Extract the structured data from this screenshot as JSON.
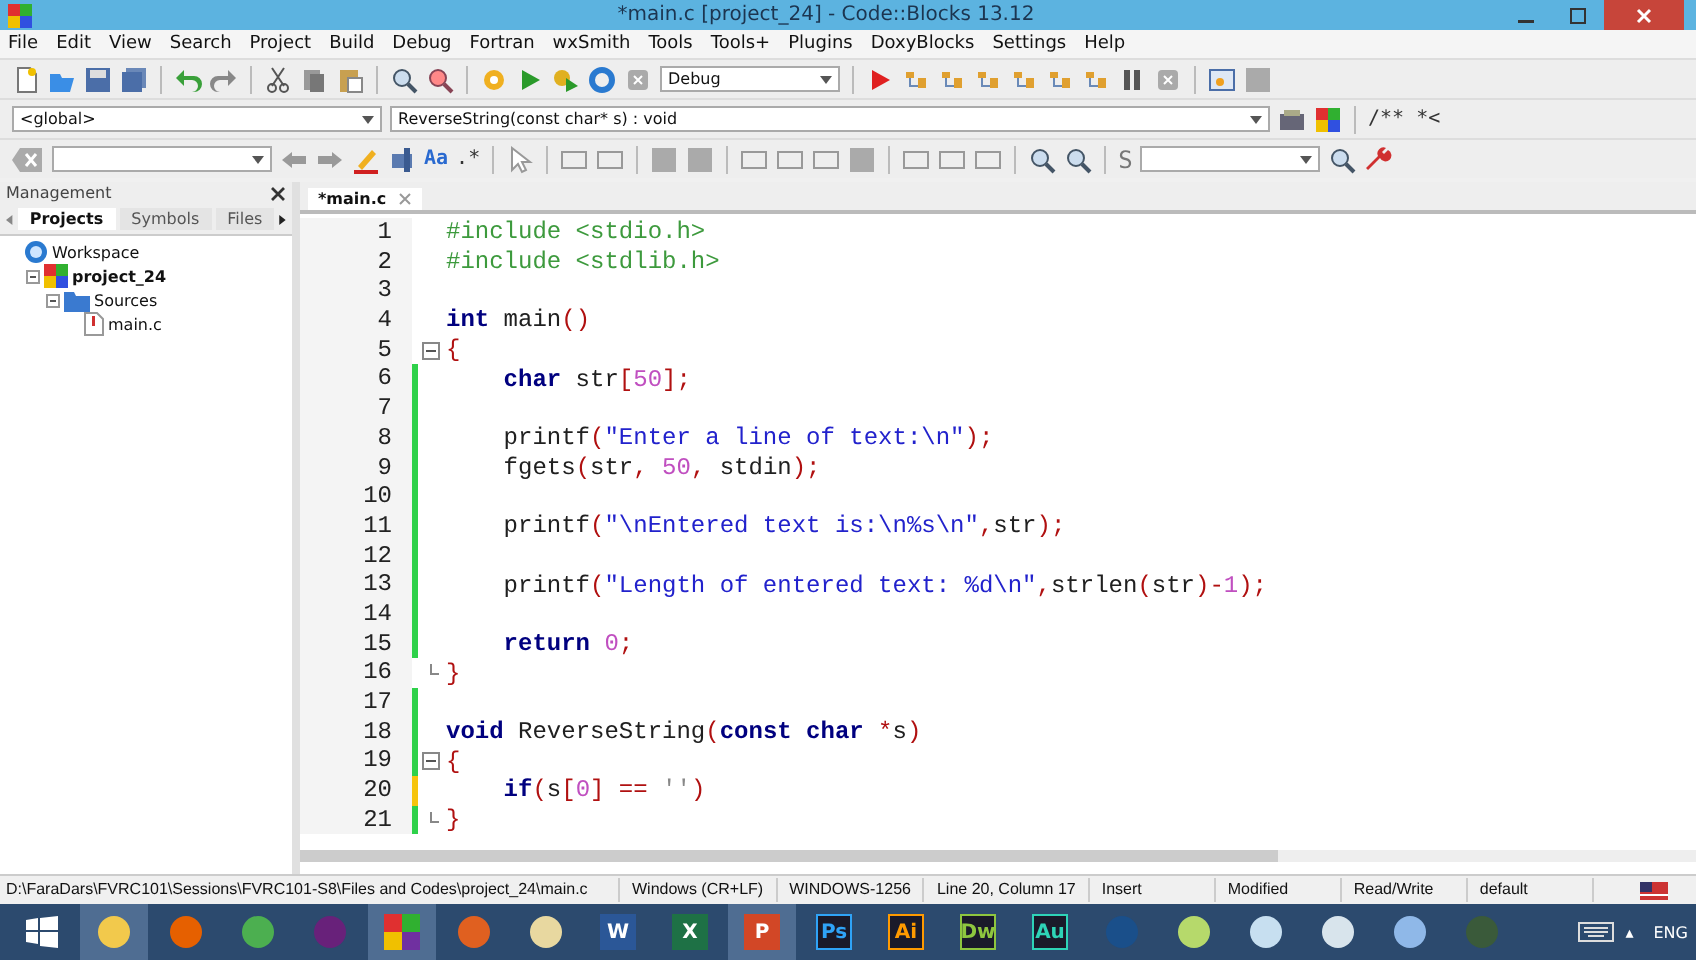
{
  "window": {
    "title": "*main.c [project_24] - Code::Blocks 13.12"
  },
  "menu": [
    "File",
    "Edit",
    "View",
    "Search",
    "Project",
    "Build",
    "Debug",
    "Fortran",
    "wxSmith",
    "Tools",
    "Tools+",
    "Plugins",
    "DoxyBlocks",
    "Settings",
    "Help"
  ],
  "toolbar": {
    "build_target": "Debug",
    "scope": "<global>",
    "function": "ReverseString(const char* s) : void",
    "doc_comment": "/** *<",
    "match_case": "Aa",
    "regex": ".*",
    "spell": "S"
  },
  "management": {
    "title": "Management",
    "tabs": [
      {
        "label": "Projects",
        "selected": true
      },
      {
        "label": "Symbols",
        "selected": false
      },
      {
        "label": "Files",
        "selected": false
      }
    ],
    "tree": [
      {
        "label": "Workspace",
        "kind": "workspace",
        "children": [
          {
            "label": "project_24",
            "kind": "project",
            "expanded": true,
            "children": [
              {
                "label": "Sources",
                "kind": "folder",
                "expanded": true,
                "children": [
                  {
                    "label": "main.c",
                    "kind": "file"
                  }
                ]
              }
            ]
          }
        ]
      }
    ]
  },
  "editor": {
    "tabs": [
      {
        "label": "*main.c",
        "selected": true
      }
    ],
    "lines": [
      {
        "n": "1",
        "tokens": [
          {
            "kind": "pre",
            "text": "#include <stdio.h>"
          }
        ]
      },
      {
        "n": "2",
        "tokens": [
          {
            "kind": "pre",
            "text": "#include <stdlib.h>"
          }
        ]
      },
      {
        "n": "3"
      },
      {
        "n": "4",
        "tokens": [
          {
            "kind": "kw",
            "text": "int"
          },
          {
            "kind": "id",
            "text": " main"
          },
          {
            "kind": "op",
            "text": "()"
          }
        ]
      },
      {
        "n": "5",
        "fold_start": true,
        "tokens": [
          {
            "kind": "op",
            "text": "{"
          }
        ]
      },
      {
        "n": "6",
        "modified": true,
        "indented": true,
        "tokens": [
          {
            "kind": "kw",
            "text": "char"
          },
          {
            "kind": "id",
            "text": " str"
          },
          {
            "kind": "op",
            "text": "["
          },
          {
            "kind": "num",
            "text": "50"
          },
          {
            "kind": "op",
            "text": "];"
          }
        ]
      },
      {
        "n": "7",
        "modified": true
      },
      {
        "n": "8",
        "modified": true,
        "indented": true,
        "tokens": [
          {
            "kind": "id",
            "text": "printf"
          },
          {
            "kind": "op",
            "text": "("
          },
          {
            "kind": "str",
            "text": "\"Enter a line of text:\\n\""
          },
          {
            "kind": "op",
            "text": ");"
          }
        ]
      },
      {
        "n": "9",
        "modified": true,
        "indented": true,
        "tokens": [
          {
            "kind": "id",
            "text": "fgets"
          },
          {
            "kind": "op",
            "text": "("
          },
          {
            "kind": "id",
            "text": "str"
          },
          {
            "kind": "op",
            "text": ", "
          },
          {
            "kind": "num",
            "text": "50"
          },
          {
            "kind": "op",
            "text": ","
          },
          {
            "kind": "id",
            "text": " stdin"
          },
          {
            "kind": "op",
            "text": ");"
          }
        ]
      },
      {
        "n": "10",
        "modified": true
      },
      {
        "n": "11",
        "modified": true,
        "indented": true,
        "tokens": [
          {
            "kind": "id",
            "text": "printf"
          },
          {
            "kind": "op",
            "text": "("
          },
          {
            "kind": "str",
            "text": "\"\\nEntered text is:\\n%s\\n\""
          },
          {
            "kind": "op",
            "text": ","
          },
          {
            "kind": "id",
            "text": "str"
          },
          {
            "kind": "op",
            "text": ");"
          }
        ]
      },
      {
        "n": "12",
        "modified": true
      },
      {
        "n": "13",
        "modified": true,
        "indented": true,
        "tokens": [
          {
            "kind": "id",
            "text": "printf"
          },
          {
            "kind": "op",
            "text": "("
          },
          {
            "kind": "str",
            "text": "\"Length of entered text: %d\\n\""
          },
          {
            "kind": "op",
            "text": ","
          },
          {
            "kind": "id",
            "text": "strlen"
          },
          {
            "kind": "op",
            "text": "("
          },
          {
            "kind": "id",
            "text": "str"
          },
          {
            "kind": "op",
            "text": ")-"
          },
          {
            "kind": "num",
            "text": "1"
          },
          {
            "kind": "op",
            "text": ");"
          }
        ]
      },
      {
        "n": "14",
        "modified": true
      },
      {
        "n": "15",
        "modified": true,
        "indented": true,
        "tokens": [
          {
            "kind": "kw",
            "text": "return"
          },
          {
            "kind": "num",
            "text": " 0"
          },
          {
            "kind": "op",
            "text": ";"
          }
        ]
      },
      {
        "n": "16",
        "fold_end": true,
        "tokens": [
          {
            "kind": "op",
            "text": "}"
          }
        ]
      },
      {
        "n": "17",
        "modified": true
      },
      {
        "n": "18",
        "modified": true,
        "tokens": [
          {
            "kind": "kw",
            "text": "void"
          },
          {
            "kind": "id",
            "text": " ReverseString"
          },
          {
            "kind": "op",
            "text": "("
          },
          {
            "kind": "kw",
            "text": "const char"
          },
          {
            "kind": "op",
            "text": " *"
          },
          {
            "kind": "id",
            "text": "s"
          },
          {
            "kind": "op",
            "text": ")"
          }
        ]
      },
      {
        "n": "19",
        "modified": true,
        "fold_start": true,
        "tokens": [
          {
            "kind": "op",
            "text": "{"
          }
        ]
      },
      {
        "n": "20",
        "modified": true,
        "unsaved": true,
        "indented": true,
        "tokens": [
          {
            "kind": "kw",
            "text": "if"
          },
          {
            "kind": "op",
            "text": "("
          },
          {
            "kind": "id",
            "text": "s"
          },
          {
            "kind": "op",
            "text": "["
          },
          {
            "kind": "num",
            "text": "0"
          },
          {
            "kind": "op",
            "text": "] == "
          },
          {
            "kind": "chr",
            "text": "''"
          },
          {
            "kind": "op",
            "text": ")"
          }
        ]
      },
      {
        "n": "21",
        "modified": true,
        "fold_end": true,
        "tokens": [
          {
            "kind": "op",
            "text": "}"
          }
        ]
      }
    ]
  },
  "status_bar": [
    "D:\\FaraDars\\FVRC101\\Sessions\\FVRC101-S8\\Files and Codes\\project_24\\main.c",
    "Windows (CR+LF)",
    "WINDOWS-1256",
    "Line 20, Column 17",
    "Insert",
    "Modified",
    "Read/Write",
    "default"
  ],
  "taskbar": {
    "items": [
      {
        "kind": "start",
        "highlighted": false
      },
      {
        "kind": "explorer",
        "highlighted": true
      },
      {
        "kind": "firefox",
        "highlighted": false
      },
      {
        "kind": "chrome",
        "highlighted": false
      },
      {
        "kind": "vs",
        "highlighted": false
      },
      {
        "kind": "codeblocks",
        "highlighted": true
      },
      {
        "kind": "matlab",
        "highlighted": false
      },
      {
        "kind": "pen",
        "highlighted": false
      },
      {
        "kind": "office",
        "label": "W",
        "color": "#2b5797",
        "highlighted": false
      },
      {
        "kind": "office",
        "label": "X",
        "color": "#1e7145",
        "highlighted": false
      },
      {
        "kind": "office",
        "label": "P",
        "color": "#d24726",
        "highlighted": true
      },
      {
        "kind": "adobe",
        "label": "Ps",
        "color": "#2fa3f7",
        "highlighted": false
      },
      {
        "kind": "adobe",
        "label": "Ai",
        "color": "#ff9a00",
        "highlighted": false
      },
      {
        "kind": "adobe",
        "label": "Dw",
        "color": "#8ec63f",
        "highlighted": false
      },
      {
        "kind": "adobe",
        "label": "Au",
        "color": "#2ed3b7",
        "highlighted": false
      },
      {
        "kind": "disc",
        "highlighted": false
      },
      {
        "kind": "chart",
        "highlighted": false
      },
      {
        "kind": "notes",
        "highlighted": false
      },
      {
        "kind": "calc",
        "highlighted": false
      },
      {
        "kind": "paint",
        "highlighted": false
      },
      {
        "kind": "cmd",
        "highlighted": false
      }
    ],
    "tray_arrow": "▴",
    "language": "ENG"
  }
}
